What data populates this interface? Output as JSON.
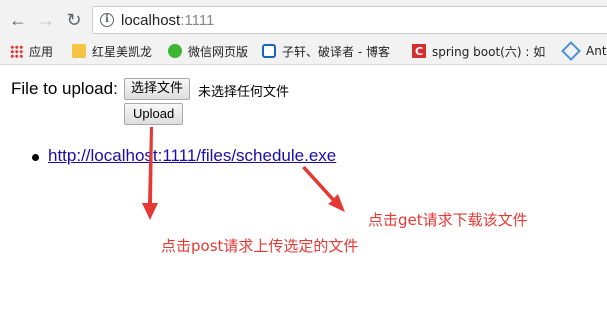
{
  "browser": {
    "back_icon": "arrow-left-icon",
    "forward_icon": "arrow-right-icon",
    "reload_icon": "reload-icon",
    "url_host": "localhost",
    "url_port": ":1111"
  },
  "bookmarks": [
    {
      "label": "应用",
      "icon": "apps-grid-icon"
    },
    {
      "label": "红星美凯龙",
      "icon": "folder-icon"
    },
    {
      "label": "微信网页版",
      "icon": "wechat-icon"
    },
    {
      "label": "子轩、破译者 - 博客",
      "icon": "blog-icon"
    },
    {
      "label": "spring boot(六) : 如",
      "icon": "csdn-icon"
    },
    {
      "label": "Ant",
      "icon": "diamond-icon"
    }
  ],
  "form": {
    "file_label": "File to upload:",
    "choose_button": "选择文件",
    "no_file_text": "未选择任何文件",
    "upload_button": "Upload"
  },
  "files": [
    {
      "link": "http://localhost:1111/files/schedule.exe"
    }
  ],
  "annotations": {
    "get_note": "点击get请求下载该文件",
    "post_note": "点击post请求上传选定的文件",
    "color": "#e53935"
  }
}
